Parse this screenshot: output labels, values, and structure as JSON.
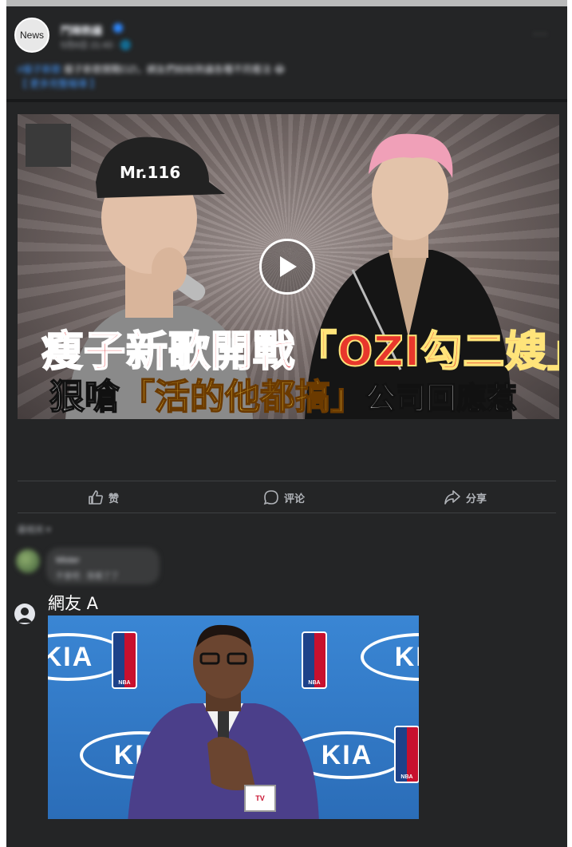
{
  "post": {
    "avatar_text": "News",
    "page_name": "鬥陣熱議",
    "meta": "5月6日 21:43 · 🌐",
    "more": "···",
    "text_tag": "#瘦子新歌",
    "text": " 瘦子新歌開戰OZI，網友們紛紛熱議各種不同看法 😂",
    "text_link": "【 更多完整報導 】"
  },
  "video": {
    "cap_text": "Mr.116",
    "headline_line1_a": "瘦子新歌開戰",
    "headline_line1_b": "「OZI勾二嫂」",
    "headline_line2_a": "狠嗆",
    "headline_line2_b": "「活的他都搞」",
    "headline_line2_c": "公司回應惹"
  },
  "actions": {
    "like": "赞",
    "comment": "评论",
    "share": "分享"
  },
  "comments_sort": "最相关 ▾",
  "blurred_comment": {
    "name": "Mister",
    "body": "不會吧 · 我看了了"
  },
  "user_comment": {
    "name": "網友 A",
    "image_alt": "KIA NBA press conference",
    "kia_text": "KIA",
    "nba_text": "NBA",
    "mic_text": "TV"
  },
  "colors": {
    "card_bg": "#242526",
    "text_primary": "#e4e6eb",
    "text_secondary": "#b0b3b8",
    "link": "#4599ff"
  }
}
